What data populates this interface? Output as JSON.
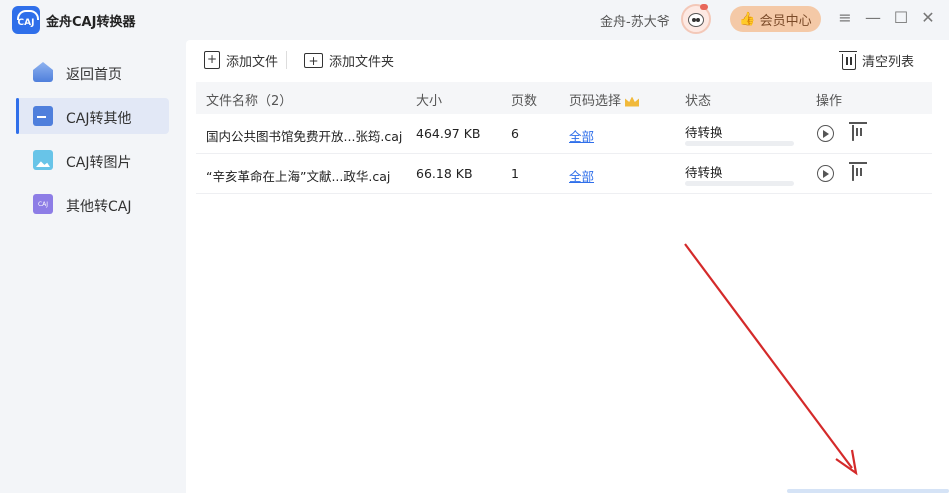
{
  "app": {
    "title": "金舟CAJ转换器",
    "logo_text": "CAJ",
    "username": "金舟-苏大爷",
    "vip_label": "会员中心",
    "window_controls": [
      "menu-icon",
      "minimize-icon",
      "maximize-icon",
      "close-icon"
    ]
  },
  "sidebar": {
    "items": [
      {
        "label": "返回首页",
        "icon": "home-icon",
        "active": false
      },
      {
        "label": "CAJ转其他",
        "icon": "caj-icon",
        "active": true
      },
      {
        "label": "CAJ转图片",
        "icon": "image-icon",
        "active": false
      },
      {
        "label": "其他转CAJ",
        "icon": "other-caj-icon",
        "active": false
      }
    ]
  },
  "toolbar": {
    "add_file": "添加文件",
    "add_folder": "添加文件夹",
    "clear_list": "清空列表"
  },
  "table": {
    "headers": {
      "name": "文件名称（2）",
      "size": "大小",
      "pages": "页数",
      "page_select": "页码选择",
      "status": "状态",
      "actions": "操作"
    },
    "rows": [
      {
        "name": "国内公共图书馆免费开放...张筠.caj",
        "size": "464.97 KB",
        "pages": "6",
        "page_select": "全部",
        "status": "待转换",
        "progress": 0
      },
      {
        "name": "“辛亥革命在上海”文献...政华.caj",
        "size": "66.18 KB",
        "pages": "1",
        "page_select": "全部",
        "status": "待转换",
        "progress": 0
      }
    ]
  },
  "colors": {
    "accent": "#2f6fea",
    "vip_bg": "#f4c9a7",
    "annotation_arrow": "#d42a2a"
  }
}
